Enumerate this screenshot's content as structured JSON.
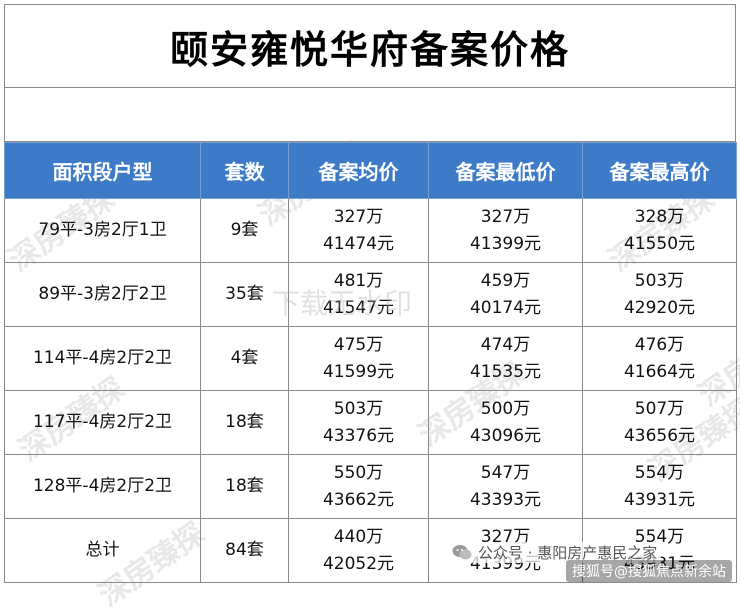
{
  "title": "颐安雍悦华府备案价格",
  "table": {
    "headers": [
      "面积段户型",
      "套数",
      "备案均价",
      "备案最低价",
      "备案最高价"
    ],
    "rows": [
      {
        "type": "79平-3房2厅1卫",
        "count": "9套",
        "avg_total": "327万",
        "avg_unit": "41474元",
        "min_total": "327万",
        "min_unit": "41399元",
        "max_total": "328万",
        "max_unit": "41550元"
      },
      {
        "type": "89平-3房2厅2卫",
        "count": "35套",
        "avg_total": "481万",
        "avg_unit": "41547元",
        "min_total": "459万",
        "min_unit": "40174元",
        "max_total": "503万",
        "max_unit": "42920元"
      },
      {
        "type": "114平-4房2厅2卫",
        "count": "4套",
        "avg_total": "475万",
        "avg_unit": "41599元",
        "min_total": "474万",
        "min_unit": "41535元",
        "max_total": "476万",
        "max_unit": "41664元"
      },
      {
        "type": "117平-4房2厅2卫",
        "count": "18套",
        "avg_total": "503万",
        "avg_unit": "43376元",
        "min_total": "500万",
        "min_unit": "43096元",
        "max_total": "507万",
        "max_unit": "43656元"
      },
      {
        "type": "128平-4房2厅2卫",
        "count": "18套",
        "avg_total": "550万",
        "avg_unit": "43662元",
        "min_total": "547万",
        "min_unit": "43393元",
        "max_total": "554万",
        "max_unit": "43931元"
      },
      {
        "type": "总计",
        "count": "84套",
        "avg_total": "440万",
        "avg_unit": "42052元",
        "min_total": "327万",
        "min_unit": "41399元",
        "max_total": "554万",
        "max_unit": "43931元"
      }
    ]
  },
  "watermarks": {
    "brand": "深房臻探",
    "center": "下载无水印",
    "wechat": "公众号 · 惠阳房产惠民之家",
    "credit": "搜狐号@搜狐焦点新余站"
  },
  "colors": {
    "header_bg": "#3d7bc8",
    "header_text": "#ffffff"
  }
}
